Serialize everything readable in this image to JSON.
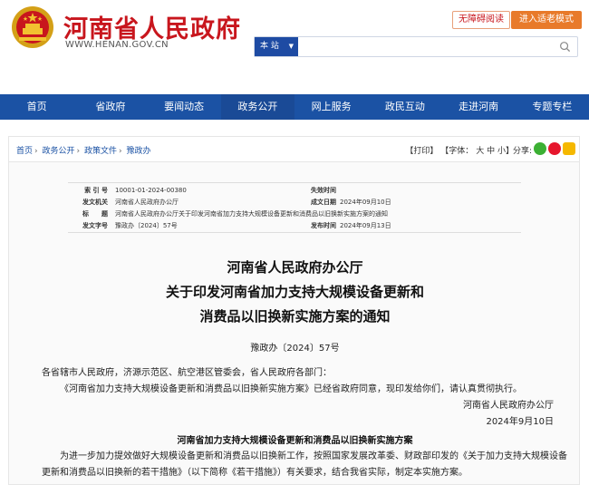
{
  "header": {
    "site_title": "河南省人民政府",
    "site_url": "WWW.HENAN.GOV.CN",
    "a11y_label": "无障碍阅读",
    "elder_label": "进入适老模式",
    "search_scope": "本 站",
    "search_value": ""
  },
  "nav": {
    "items": [
      "首页",
      "省政府",
      "要闻动态",
      "政务公开",
      "网上服务",
      "政民互动",
      "走进河南",
      "专题专栏"
    ]
  },
  "breadcrumb": [
    "首页",
    "政务公开",
    "政策文件",
    "豫政办"
  ],
  "tools": {
    "print": "【打印】",
    "font": "【字体：",
    "font_large": "大",
    "font_mid": "中",
    "font_small": "小",
    "font_end": "】",
    "share": "分享:"
  },
  "meta": {
    "index_k": "索 引 号",
    "index_v": "10001-01-2024-00380",
    "expire_k": "失效时间",
    "expire_v": "",
    "issuer_k": "发文机关",
    "issuer_v": "河南省人民政府办公厅",
    "date_k": "成文日期",
    "date_v": "2024年09月10日",
    "title_k": "标　　题",
    "title_v": "河南省人民政府办公厅关于印发河南省加力支持大规模设备更新和消费品以旧换新实施方案的通知",
    "docno_k": "发文字号",
    "docno_v": "豫政办〔2024〕57号",
    "pub_k": "发布时间",
    "pub_v": "2024年09月13日"
  },
  "doc": {
    "title_1": "河南省人民政府办公厅",
    "title_2": "关于印发河南省加力支持大规模设备更新和",
    "title_3": "消费品以旧换新实施方案的通知",
    "doc_no": "豫政办〔2024〕57号",
    "salutation": "各省辖市人民政府，济源示范区、航空港区管委会，省人民政府各部门：",
    "body_1": "《河南省加力支持大规模设备更新和消费品以旧换新实施方案》已经省政府同意，现印发给你们，请认真贯彻执行。",
    "sign_org": "河南省人民政府办公厅",
    "sign_date": "2024年9月10日",
    "subhead": "河南省加力支持大规模设备更新和消费品以旧换新实施方案",
    "body_2a": "为进一步加力提效做好大规模设备更新和消费品以旧换新工作，按照国家发展改革委、财政部印发的《关于加力支持大规模设备",
    "body_2b": "更新和消费品以旧换新的若干措施》（以下简称《若干措施》）有关要求，结合我省实际，制定本实施方案。"
  },
  "colors": {
    "brand_red": "#c8161d",
    "nav_blue": "#1b52a4",
    "elder_orange": "#e87a2a"
  }
}
